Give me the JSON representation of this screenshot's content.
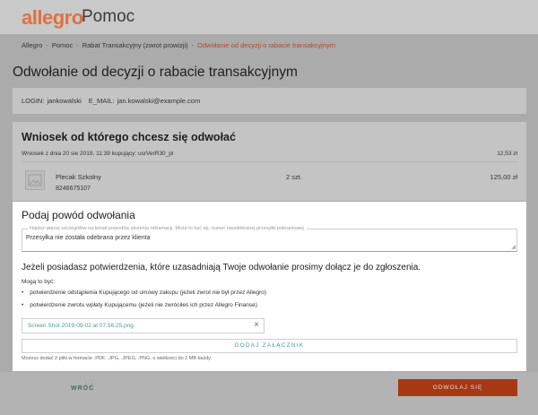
{
  "header": {
    "logo": "allegro",
    "subtitle": "Pomoc"
  },
  "breadcrumb": {
    "items": [
      "Allegro",
      "Pomoc",
      "Rabat Transakcyjny (zwrot prowizji)"
    ],
    "current": "Odwołanie od decyzji o rabacie transakcyjnym",
    "separator": "-"
  },
  "page": {
    "title": "Odwołanie od decyzji o rabacie transakcyjnym"
  },
  "login": {
    "login_label": "LOGIN:",
    "login_value": "jankowalski",
    "email_label": "E_MAIL:",
    "email_value": "jan.kowalski@example.com"
  },
  "order": {
    "title": "Wniosek od którego chcesz się odwołać",
    "meta": "Wniosek z dnia 20 sie 2019, 11:39 kupujący: usrVerR30_pl",
    "weight": "12,53 zł",
    "product_name": "Plecak Szkolny",
    "product_code": "8246675107",
    "quantity": "2 szt.",
    "price": "125,00 zł"
  },
  "modal": {
    "title": "Podaj powód odwołania",
    "reason_placeholder": "Napisz więcej szczegółów na temat powodów złożenia reklamacji. Może to być np. numer nieodebranej przesyłki pobraniowej.",
    "reason_value": "Przesyłka nie została odebrana przez klienta",
    "confirm_heading": "Jeżeli posiadasz potwierdzenia, które uzasadniają Twoje odwołanie prosimy dołącz je do zgłoszenia.",
    "may_be": "Mogą to być:",
    "bullets": [
      "potwierdzenie odstąpienia Kupującego od umowy zakupu (jeżeli zwrot nie był przez Allegro)",
      "potwierdzenie zwrotu wpłaty Kupującemu (jeżeli nie zwróciłeś ich przez Allegro Finanse)"
    ],
    "attachment_name": "Screen Shot 2019-09-02 at 07.56.25.png",
    "remove_glyph": "×",
    "add_attachment_label": "DODAJ ZAŁĄCZNIK",
    "hint": "Możesz dodać 2 pliki w formacie .PDF, .JPG, .JPEG, .PNG, o wielkości do 2 MB każdy."
  },
  "footer": {
    "back_label": "WRÓĆ",
    "appeal_label": "ODWOŁAJ SIĘ"
  },
  "colors": {
    "brand": "#e0713c",
    "accent": "#4a9b9b",
    "primary_button": "#a73814"
  }
}
